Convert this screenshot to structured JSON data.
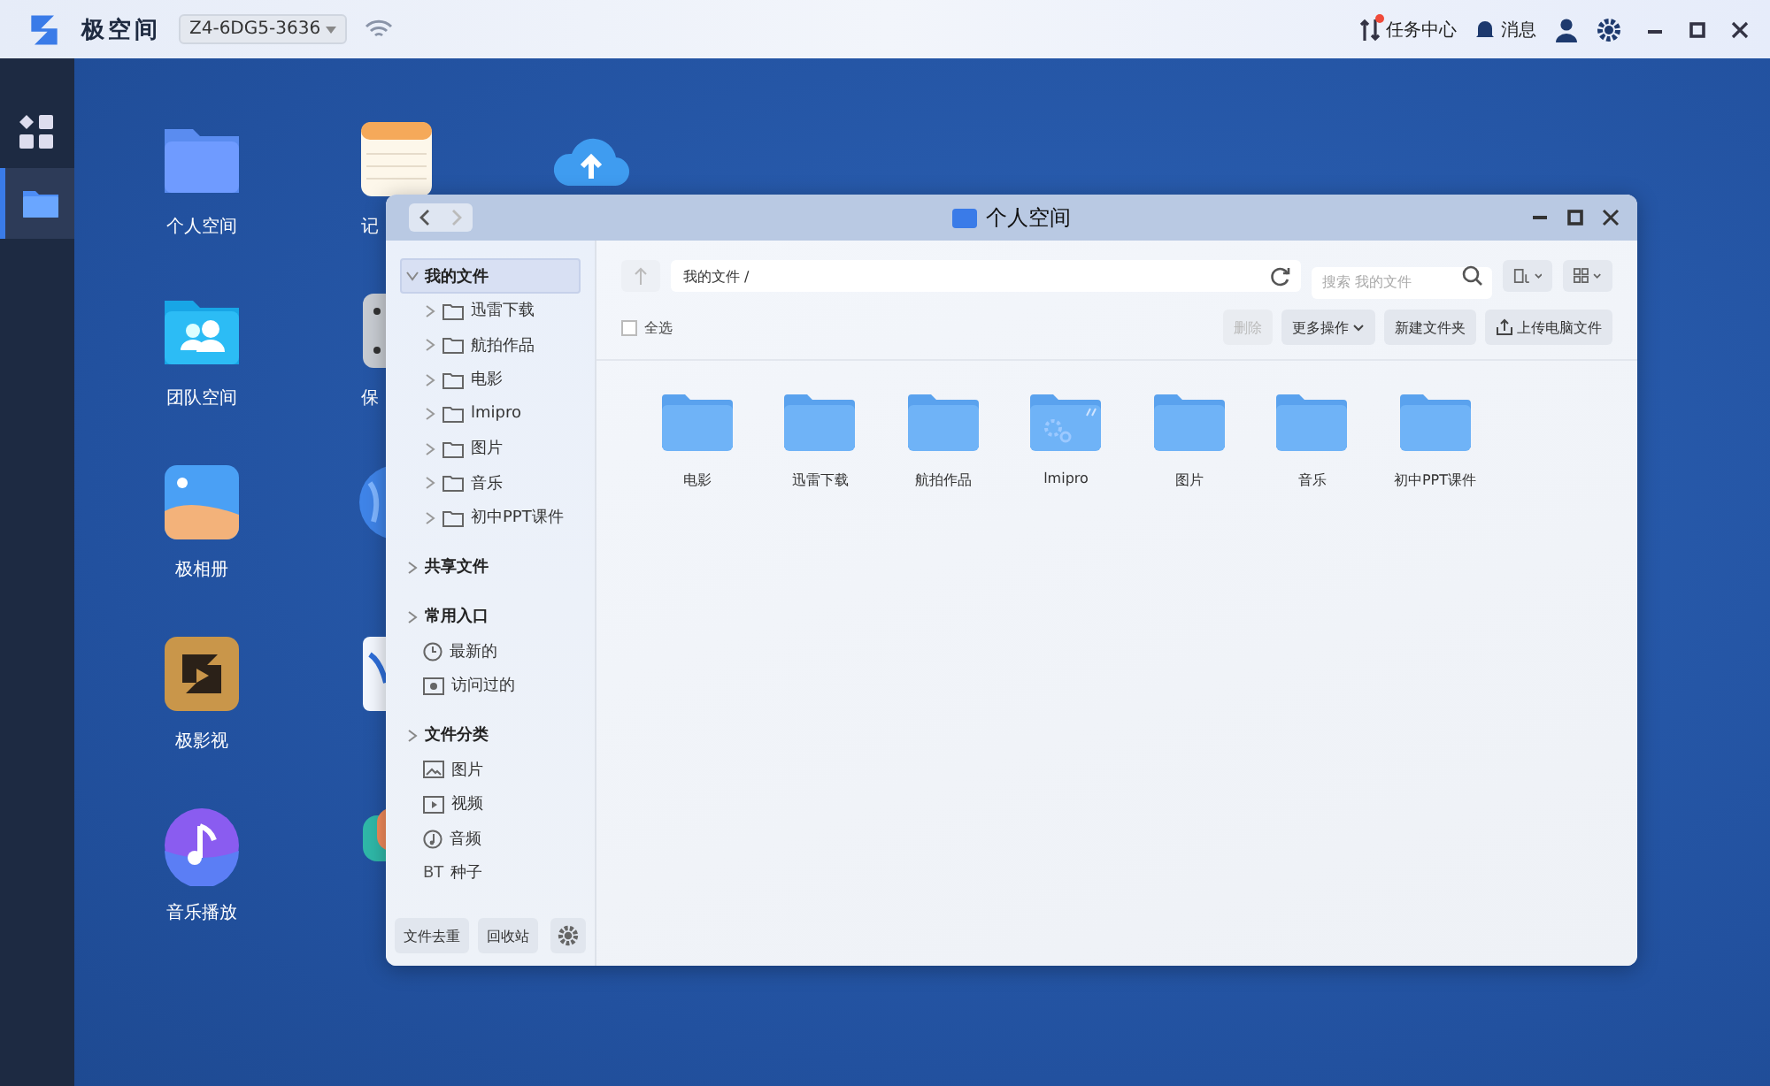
{
  "topbar": {
    "app_name": "极空间",
    "device": "Z4-6DG5-3636",
    "tasks": "任务中心",
    "tasks_badge": true,
    "messages": "消息"
  },
  "dock": [
    {
      "kind": "apps",
      "selected": false
    },
    {
      "kind": "folder",
      "selected": true
    }
  ],
  "desktop_columns": [
    [
      {
        "kind": "folder",
        "label": "个人空间"
      },
      {
        "kind": "team",
        "label": "团队空间"
      },
      {
        "kind": "photos",
        "label": "极相册"
      },
      {
        "kind": "video",
        "label": "极影视"
      },
      {
        "kind": "music",
        "label": "音乐播放"
      }
    ],
    [
      {
        "kind": "notes",
        "label": "记"
      },
      {
        "kind": "storage",
        "label": "保",
        "covered": true
      },
      {
        "kind": "globe",
        "covered": true
      },
      {
        "kind": "doc",
        "covered": true
      },
      {
        "kind": "chat",
        "covered": true
      }
    ],
    [
      {
        "kind": "cloud"
      }
    ]
  ],
  "window": {
    "title": "个人空间",
    "sidebar": {
      "sections": [
        {
          "label": "我的文件",
          "expanded": true,
          "selected": true,
          "items": [
            {
              "kind": "folder",
              "label": "迅雷下载"
            },
            {
              "kind": "folder",
              "label": "航拍作品"
            },
            {
              "kind": "folder",
              "label": "电影"
            },
            {
              "kind": "folder",
              "label": "lmipro"
            },
            {
              "kind": "folder",
              "label": "图片"
            },
            {
              "kind": "folder",
              "label": "音乐"
            },
            {
              "kind": "folder",
              "label": "初中PPT课件"
            }
          ]
        },
        {
          "label": "共享文件",
          "expanded": false,
          "selected": false
        },
        {
          "label": "常用入口",
          "expanded": false,
          "selected": false,
          "items": [
            {
              "kind": "clock",
              "label": "最新的"
            },
            {
              "kind": "eye",
              "label": "访问过的"
            }
          ]
        },
        {
          "label": "文件分类",
          "expanded": false,
          "selected": false,
          "items": [
            {
              "kind": "image",
              "label": "图片"
            },
            {
              "kind": "video",
              "label": "视频"
            },
            {
              "kind": "audio",
              "label": "音频"
            },
            {
              "kind": "text",
              "icon": "BT",
              "label": "种子"
            }
          ]
        }
      ],
      "footer": [
        "文件去重",
        "回收站"
      ]
    },
    "path": "我的文件 /",
    "search_placeholder": "搜索 我的文件",
    "select_all": {
      "label": "全选",
      "checked": false
    },
    "actions": [
      {
        "label": "删除",
        "kind": "plain",
        "disabled": true
      },
      {
        "label": "更多操作",
        "kind": "dropdown",
        "disabled": false
      },
      {
        "label": "新建文件夹",
        "kind": "plain",
        "disabled": false
      },
      {
        "label": "上传电脑文件",
        "kind": "upload",
        "disabled": false
      }
    ],
    "files": [
      {
        "name": "电影",
        "kind": "folder"
      },
      {
        "name": "迅雷下载",
        "kind": "folder"
      },
      {
        "name": "航拍作品",
        "kind": "folder"
      },
      {
        "name": "lmipro",
        "kind": "app"
      },
      {
        "name": "图片",
        "kind": "folder"
      },
      {
        "name": "音乐",
        "kind": "folder"
      },
      {
        "name": "初中PPT课件",
        "kind": "folder"
      }
    ]
  }
}
